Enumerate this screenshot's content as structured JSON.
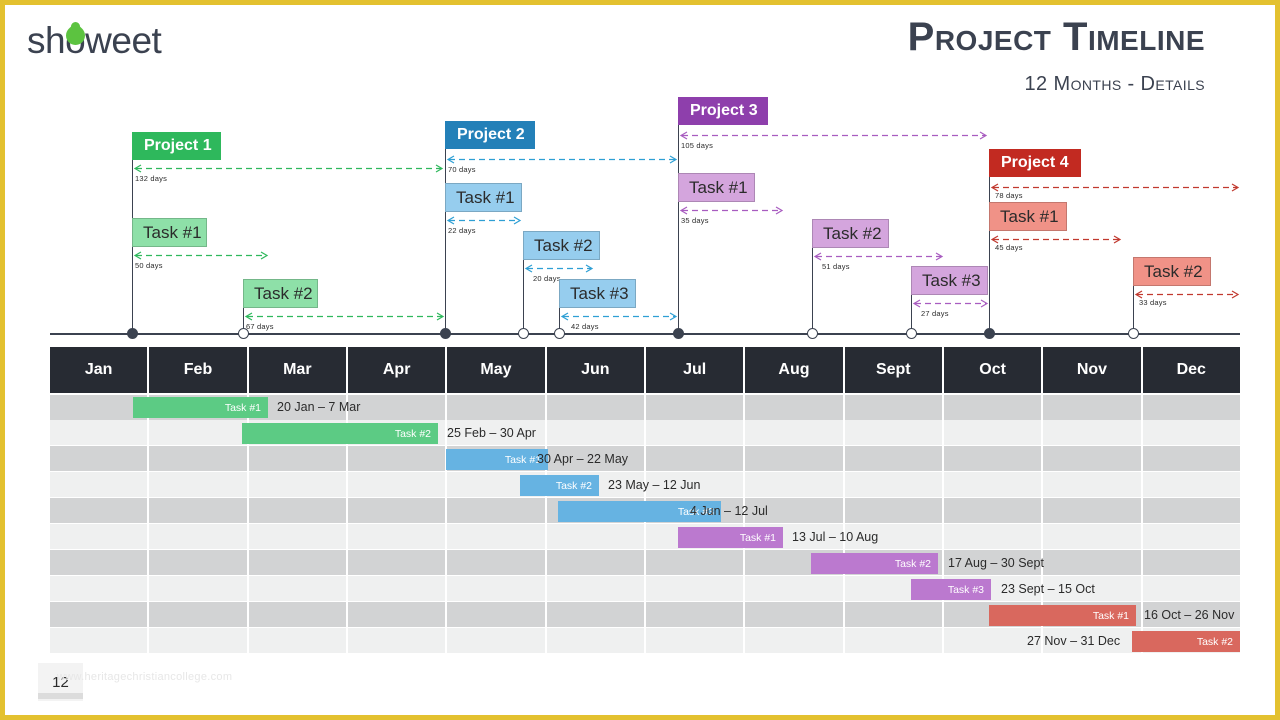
{
  "brand": {
    "logo_text": "showeet",
    "logo_icon": "leaf-icon"
  },
  "header": {
    "title": "Project Timeline",
    "subtitle": "12 Months - Details"
  },
  "colors": {
    "frame": "#e3c12f",
    "header_dark": "#272b33",
    "row_dark": "#d2d3d4",
    "row_light": "#eff0f0",
    "green_project": "#2eb85c",
    "green_task": "#8ee0a8",
    "green_bar": "#5ccb84",
    "blue_project": "#2380b8",
    "blue_task": "#96cdee",
    "blue_bar": "#66b3e2",
    "purple_project": "#8e3fac",
    "purple_task": "#d4a5dd",
    "purple_bar": "#bb79cf",
    "red_project": "#c22a21",
    "red_task": "#f09287",
    "red_bar": "#d9685e"
  },
  "months": [
    {
      "label": "Jan"
    },
    {
      "label": "Feb"
    },
    {
      "label": "Mar"
    },
    {
      "label": "Apr"
    },
    {
      "label": "May"
    },
    {
      "label": "Jun"
    },
    {
      "label": "Jul"
    },
    {
      "label": "Aug"
    },
    {
      "label": "Sept"
    },
    {
      "label": "Oct"
    },
    {
      "label": "Nov"
    },
    {
      "label": "Dec"
    }
  ],
  "milestones": {
    "projects": [
      {
        "name": "Project 1",
        "duration": "132 days",
        "color": "green"
      },
      {
        "name": "Project 2",
        "duration": "70 days",
        "color": "blue"
      },
      {
        "name": "Project 3",
        "duration": "105 days",
        "color": "purple"
      },
      {
        "name": "Project 4",
        "duration": "78 days",
        "color": "red"
      }
    ],
    "tasks": [
      {
        "project": "Project 1",
        "name": "Task #1",
        "duration": "50 days",
        "color": "green"
      },
      {
        "project": "Project 1",
        "name": "Task #2",
        "duration": "67 days",
        "color": "green"
      },
      {
        "project": "Project 2",
        "name": "Task #1",
        "duration": "22 days",
        "color": "blue"
      },
      {
        "project": "Project 2",
        "name": "Task #2",
        "duration": "20 days",
        "color": "blue"
      },
      {
        "project": "Project 2",
        "name": "Task #3",
        "duration": "42 days",
        "color": "blue"
      },
      {
        "project": "Project 3",
        "name": "Task #1",
        "duration": "35 days",
        "color": "purple"
      },
      {
        "project": "Project 3",
        "name": "Task #2",
        "duration": "51 days",
        "color": "purple"
      },
      {
        "project": "Project 3",
        "name": "Task #3",
        "duration": "27 days",
        "color": "purple"
      },
      {
        "project": "Project 4",
        "name": "Task #1",
        "duration": "45 days",
        "color": "red"
      },
      {
        "project": "Project 4",
        "name": "Task #2",
        "duration": "33 days",
        "color": "red"
      }
    ]
  },
  "gantt_rows": [
    {
      "label": "Task #1",
      "dates": "20 Jan – 7 Mar",
      "color": "green"
    },
    {
      "label": "Task #2",
      "dates": "25 Feb – 30 Apr",
      "color": "green"
    },
    {
      "label": "Task #1",
      "dates": "30 Apr – 22 May",
      "color": "blue"
    },
    {
      "label": "Task #2",
      "dates": "23 May – 12 Jun",
      "color": "blue"
    },
    {
      "label": "Task #3",
      "dates": "4 Jun – 12 Jul",
      "color": "blue"
    },
    {
      "label": "Task #1",
      "dates": "13 Jul – 10 Aug",
      "color": "purple"
    },
    {
      "label": "Task #2",
      "dates": "17 Aug – 30 Sept",
      "color": "purple"
    },
    {
      "label": "Task #3",
      "dates": "23 Sept – 15 Oct",
      "color": "purple"
    },
    {
      "label": "Task #1",
      "dates": "16 Oct – 26 Nov",
      "color": "red"
    },
    {
      "label": "Task #2",
      "dates": "27 Nov – 31 Dec",
      "color": "red"
    }
  ],
  "chart_data": {
    "type": "bar",
    "title": "Project Timeline - 12 Months Details",
    "xlabel": "",
    "ylabel": "",
    "categories": [
      "Jan",
      "Feb",
      "Mar",
      "Apr",
      "May",
      "Jun",
      "Jul",
      "Aug",
      "Sept",
      "Oct",
      "Nov",
      "Dec"
    ],
    "series": [
      {
        "name": "Project 1 / Task #1",
        "start": "20 Jan",
        "end": "7 Mar",
        "duration_days": 50,
        "color": "#5ccb84"
      },
      {
        "name": "Project 1 / Task #2",
        "start": "25 Feb",
        "end": "30 Apr",
        "duration_days": 67,
        "color": "#5ccb84"
      },
      {
        "name": "Project 2 / Task #1",
        "start": "30 Apr",
        "end": "22 May",
        "duration_days": 22,
        "color": "#66b3e2"
      },
      {
        "name": "Project 2 / Task #2",
        "start": "23 May",
        "end": "12 Jun",
        "duration_days": 20,
        "color": "#66b3e2"
      },
      {
        "name": "Project 2 / Task #3",
        "start": "4 Jun",
        "end": "12 Jul",
        "duration_days": 42,
        "color": "#66b3e2"
      },
      {
        "name": "Project 3 / Task #1",
        "start": "13 Jul",
        "end": "10 Aug",
        "duration_days": 35,
        "color": "#bb79cf"
      },
      {
        "name": "Project 3 / Task #2",
        "start": "17 Aug",
        "end": "30 Sept",
        "duration_days": 51,
        "color": "#bb79cf"
      },
      {
        "name": "Project 3 / Task #3",
        "start": "23 Sept",
        "end": "15 Oct",
        "duration_days": 27,
        "color": "#bb79cf"
      },
      {
        "name": "Project 4 / Task #1",
        "start": "16 Oct",
        "end": "26 Nov",
        "duration_days": 45,
        "color": "#d9685e"
      },
      {
        "name": "Project 4 / Task #2",
        "start": "27 Nov",
        "end": "31 Dec",
        "duration_days": 33,
        "color": "#d9685e"
      }
    ],
    "project_totals": [
      {
        "name": "Project 1",
        "duration_days": 132
      },
      {
        "name": "Project 2",
        "duration_days": 70
      },
      {
        "name": "Project 3",
        "duration_days": 105
      },
      {
        "name": "Project 4",
        "duration_days": 78
      }
    ],
    "legend": "none",
    "grid": true
  },
  "footer": {
    "page_number": "12",
    "watermark": "www.heritagechristiancollege.com"
  }
}
